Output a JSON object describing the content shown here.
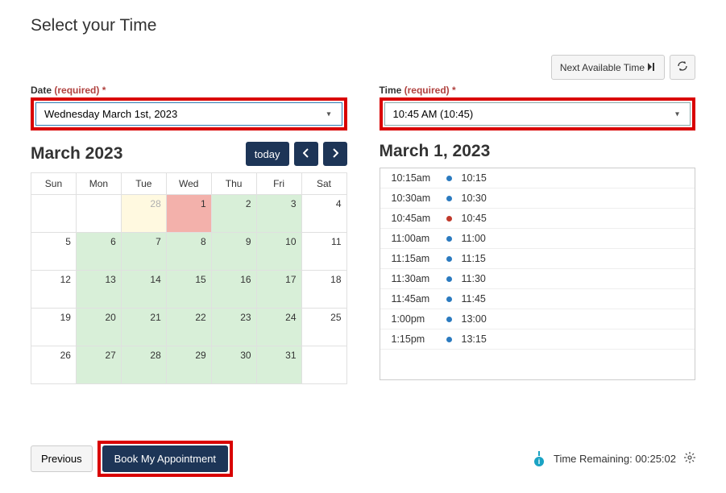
{
  "heading": "Select your Time",
  "top": {
    "next_label": "Next Available Time",
    "refresh_icon": "refresh"
  },
  "date": {
    "label": "Date",
    "required": "(required)",
    "star": "*",
    "value": "Wednesday March 1st, 2023"
  },
  "time": {
    "label": "Time",
    "required": "(required)",
    "star": "*",
    "value": "10:45 AM (10:45)"
  },
  "calendar": {
    "month": "March 2023",
    "today_label": "today",
    "dows": [
      "Sun",
      "Mon",
      "Tue",
      "Wed",
      "Thu",
      "Fri",
      "Sat"
    ],
    "weeks": [
      [
        {
          "n": "",
          "cls": ""
        },
        {
          "n": "",
          "cls": ""
        },
        {
          "n": "28",
          "cls": "past"
        },
        {
          "n": "1",
          "cls": "selected"
        },
        {
          "n": "2",
          "cls": "avail"
        },
        {
          "n": "3",
          "cls": "avail"
        },
        {
          "n": "4",
          "cls": ""
        }
      ],
      [
        {
          "n": "5",
          "cls": ""
        },
        {
          "n": "6",
          "cls": "avail"
        },
        {
          "n": "7",
          "cls": "avail"
        },
        {
          "n": "8",
          "cls": "avail"
        },
        {
          "n": "9",
          "cls": "avail"
        },
        {
          "n": "10",
          "cls": "avail"
        },
        {
          "n": "11",
          "cls": ""
        }
      ],
      [
        {
          "n": "12",
          "cls": ""
        },
        {
          "n": "13",
          "cls": "avail"
        },
        {
          "n": "14",
          "cls": "avail"
        },
        {
          "n": "15",
          "cls": "avail"
        },
        {
          "n": "16",
          "cls": "avail"
        },
        {
          "n": "17",
          "cls": "avail"
        },
        {
          "n": "18",
          "cls": ""
        }
      ],
      [
        {
          "n": "19",
          "cls": ""
        },
        {
          "n": "20",
          "cls": "avail"
        },
        {
          "n": "21",
          "cls": "avail"
        },
        {
          "n": "22",
          "cls": "avail"
        },
        {
          "n": "23",
          "cls": "avail"
        },
        {
          "n": "24",
          "cls": "avail"
        },
        {
          "n": "25",
          "cls": ""
        }
      ],
      [
        {
          "n": "26",
          "cls": ""
        },
        {
          "n": "27",
          "cls": "avail"
        },
        {
          "n": "28",
          "cls": "avail"
        },
        {
          "n": "29",
          "cls": "avail"
        },
        {
          "n": "30",
          "cls": "avail"
        },
        {
          "n": "31",
          "cls": "avail"
        },
        {
          "n": "",
          "cls": ""
        }
      ]
    ]
  },
  "slots": {
    "day_title": "March 1, 2023",
    "items": [
      {
        "t12": "10:15am",
        "t24": "10:15",
        "sel": false
      },
      {
        "t12": "10:30am",
        "t24": "10:30",
        "sel": false
      },
      {
        "t12": "10:45am",
        "t24": "10:45",
        "sel": true
      },
      {
        "t12": "11:00am",
        "t24": "11:00",
        "sel": false
      },
      {
        "t12": "11:15am",
        "t24": "11:15",
        "sel": false
      },
      {
        "t12": "11:30am",
        "t24": "11:30",
        "sel": false
      },
      {
        "t12": "11:45am",
        "t24": "11:45",
        "sel": false
      },
      {
        "t12": "1:00pm",
        "t24": "13:00",
        "sel": false
      },
      {
        "t12": "1:15pm",
        "t24": "13:15",
        "sel": false
      }
    ]
  },
  "footer": {
    "previous": "Previous",
    "book": "Book My Appointment",
    "time_remaining_label": "Time Remaining:",
    "time_remaining_value": "00:25:02"
  }
}
